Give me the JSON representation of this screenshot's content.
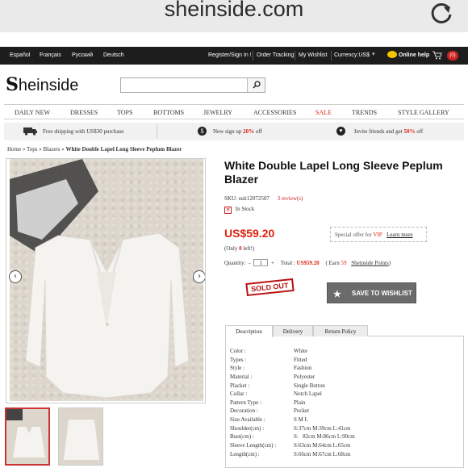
{
  "browser": {
    "url": "sheinside.com"
  },
  "topnav": {
    "languages": [
      "Español",
      "Français",
      "Русский",
      "Deutsch"
    ],
    "register": "Register/Sign In !",
    "order_tracking": "Order Tracking",
    "wishlist": "My Wishlist",
    "currency": "Currency:US$",
    "online_help": "Online help",
    "cart_count": "(0)"
  },
  "header": {
    "logo": "heinside",
    "search_placeholder": ""
  },
  "categories": [
    "DAILY NEW",
    "DRESSES",
    "TOPS",
    "BOTTOMS",
    "JEWELRY",
    "ACCESSORIES",
    "SALE",
    "TRENDS",
    "STYLE GALLERY"
  ],
  "promo": {
    "shipping": "Free shipping with US$30 purchase",
    "signup_pre": "New sign up ",
    "signup_pct": "20%",
    "signup_post": " off",
    "invite_pre": "Invite friends and get ",
    "invite_pct": "50%",
    "invite_post": " off"
  },
  "breadcrumb": {
    "home": "Home",
    "tops": "Tops",
    "blazers": "Blazers",
    "current": "White Double Lapel Long Sleeve Peplum Blazer",
    "sep": " » "
  },
  "product": {
    "title": "White Double Lapel Long Sleeve Peplum Blazer",
    "sku_label": "SKU:",
    "sku": "suit12072507",
    "reviews": "3 review(s)",
    "stock": "In Stock",
    "price": "US$59.20",
    "only_left_pre": "(Only ",
    "only_left_num": "0",
    "only_left_post": " left!)",
    "special_offer": "Special offer for ",
    "vip": "VIP",
    "learn_more": "Learn more",
    "quantity_label": "Quantity:",
    "quantity": "1",
    "total_label": "Total :",
    "total": "US$59.20",
    "earn_pre": "( Earn",
    "earn_points": "59",
    "earn_link": "Sheinside Points",
    "earn_post": ")",
    "sold_out": "SOLD OUT",
    "wishlist_button": "SAVE TO WISHLIST"
  },
  "tabs": [
    "Description",
    "Delivery",
    "Return Policy"
  ],
  "specs": [
    {
      "k": "Color :",
      "v": "White"
    },
    {
      "k": "Types :",
      "v": "Fitted"
    },
    {
      "k": "Style :",
      "v": "Fashion"
    },
    {
      "k": "Material :",
      "v": "Polyester"
    },
    {
      "k": "Placket :",
      "v": "Single Button"
    },
    {
      "k": "Collar :",
      "v": "Notch Lapel"
    },
    {
      "k": "Pattern Type :",
      "v": "Plain"
    },
    {
      "k": "Decoration :",
      "v": "Pocket"
    },
    {
      "k": "Size Available :",
      "v": "S M L"
    },
    {
      "k": "Shoulder(cm) :",
      "v": "S:37cm M:39cm L:41cm"
    },
    {
      "k": "Bust(cm) :",
      "v": "S:   82cm M:86cm L:90cm"
    },
    {
      "k": "Sleeve Length(cm) :",
      "v": "S:63cm M:64cm L:65cm"
    },
    {
      "k": "Length(cm) :",
      "v": "S:66cm M:67cm L:68cm"
    }
  ]
}
